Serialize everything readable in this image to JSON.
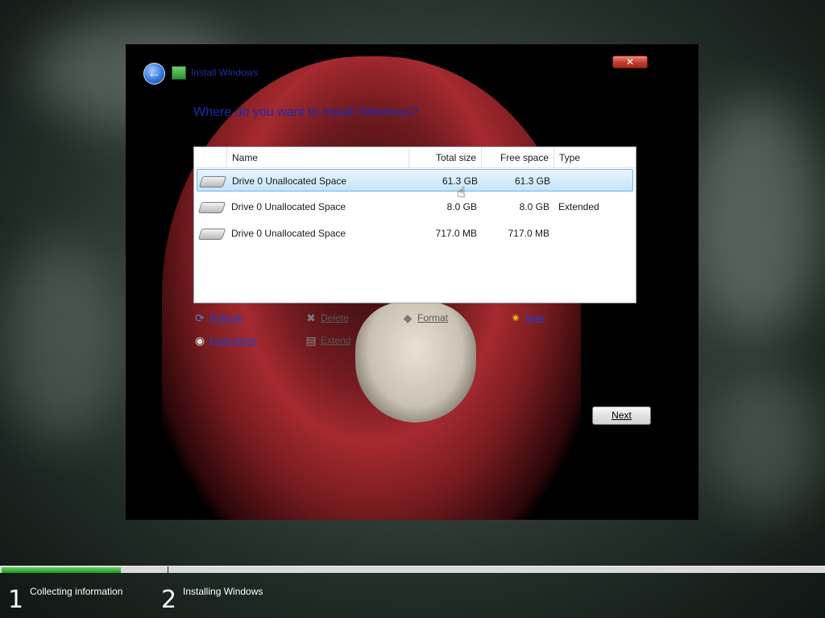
{
  "window": {
    "title": "Install Windows",
    "heading": "Where do you want to install Windows?",
    "close_glyph": "✕",
    "back_glyph": "←"
  },
  "disk_list": {
    "columns": [
      "Name",
      "Total size",
      "Free space",
      "Type"
    ],
    "rows": [
      {
        "name": "Drive 0 Unallocated Space",
        "total": "61.3 GB",
        "free": "61.3 GB",
        "type": "",
        "selected": true
      },
      {
        "name": "Drive 0 Unallocated Space",
        "total": "8.0 GB",
        "free": "8.0 GB",
        "type": "Extended",
        "selected": false
      },
      {
        "name": "Drive 0 Unallocated Space",
        "total": "717.0 MB",
        "free": "717.0 MB",
        "type": "",
        "selected": false
      }
    ]
  },
  "actions": {
    "refresh": {
      "label": "Refresh",
      "icon": "refresh-icon",
      "glyph": "⟳",
      "enabled": true
    },
    "delete": {
      "label": "Delete",
      "icon": "delete-icon",
      "glyph": "✖",
      "enabled": false
    },
    "format": {
      "label": "Format",
      "icon": "format-icon",
      "glyph": "◆",
      "enabled": false
    },
    "new": {
      "label": "New",
      "icon": "new-icon",
      "glyph": "✷",
      "enabled": true
    },
    "load_driver": {
      "label": "Load driver",
      "icon": "disc-icon",
      "glyph": "◉",
      "enabled": true
    },
    "extend": {
      "label": "Extend",
      "icon": "extend-icon",
      "glyph": "▤",
      "enabled": false
    }
  },
  "next_label": "Next",
  "progress": {
    "value": 0.145,
    "steps": [
      {
        "num": "1",
        "label": "Collecting information"
      },
      {
        "num": "2",
        "label": "Installing Windows"
      }
    ]
  },
  "colors": {
    "heading": "#1a2ab0",
    "link": "#1f3fcc",
    "selection": "#c3e4f9",
    "progress": "#1e9a25"
  }
}
